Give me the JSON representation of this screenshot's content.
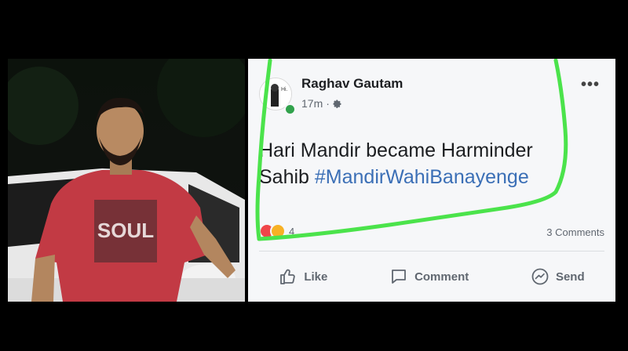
{
  "post": {
    "author": "Raghav Gautam",
    "time": "17m",
    "separator": "·",
    "text_line1": "Hari Mandir became Harminder",
    "text_line2_plain": "Sahib ",
    "hashtag": "#MandirWahiBanayenge",
    "reaction_count": "4",
    "comments": "3 Comments",
    "more": "•••"
  },
  "actions": {
    "like": "Like",
    "comment": "Comment",
    "send": "Send"
  },
  "photo": {
    "shirt_print": "SOUL"
  },
  "colors": {
    "highlight": "#4be34b",
    "hashtag": "#3b6fb6",
    "shirt": "#c23a44",
    "online": "#31a24c"
  }
}
